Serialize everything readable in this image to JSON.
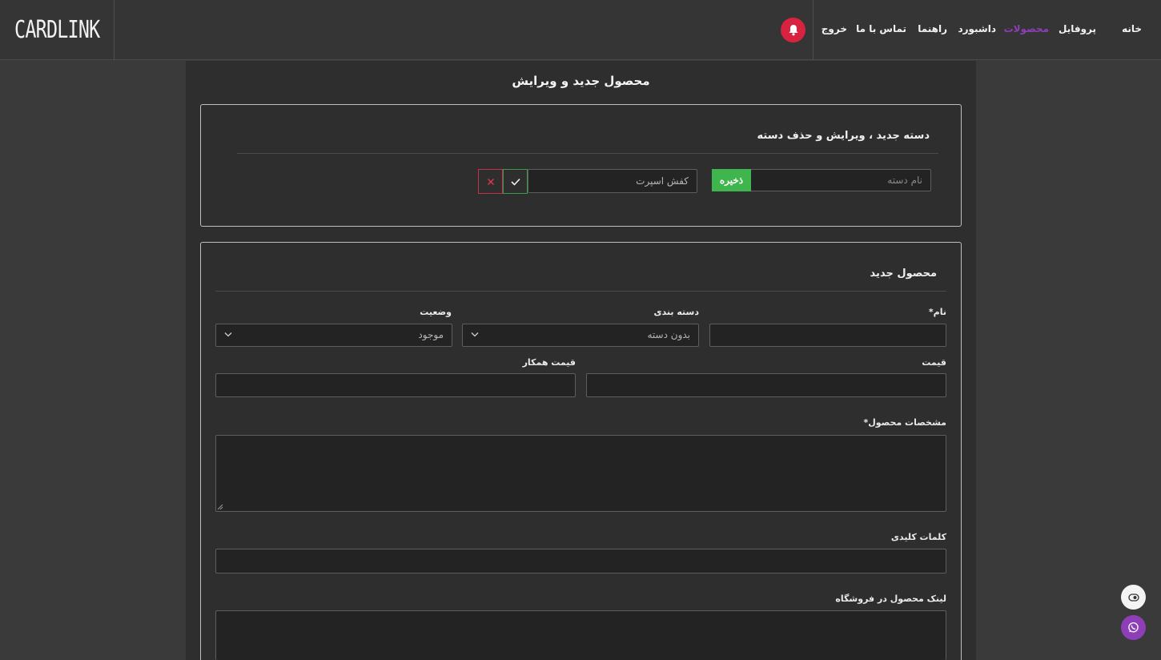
{
  "header": {
    "logo": "CARDLINK",
    "nav": [
      {
        "label": "خانه"
      },
      {
        "label": "پروفایل"
      },
      {
        "label": "محصولات"
      },
      {
        "label": "داشبورد"
      },
      {
        "label": "راهنما"
      },
      {
        "label": "تماس با ما"
      },
      {
        "label": "خروج"
      }
    ],
    "active_nav": "محصولات"
  },
  "page": {
    "title": "محصول جدید و ویرایش"
  },
  "category_card": {
    "title": "دسته جدید ، ویرایش و حذف دسته",
    "new_category_placeholder": "نام دسته",
    "save_label": "ذخیره",
    "edit_category_value": "کفش اسپرت"
  },
  "product_card": {
    "title": "محصول جدید",
    "name_label": "نام*",
    "category_label": "دسته بندی",
    "category_value": "بدون دسته",
    "status_label": "وضعیت",
    "status_value": "موجود",
    "price_label": "قیمت",
    "partner_price_label": "قیمت همکار",
    "specs_label": "مشخصات محصول*",
    "keywords_label": "کلمات کلیدی",
    "store_link_label": "لینک محصول در فروشگاه"
  },
  "colors": {
    "accent_purple": "#8e3fb8",
    "save_green": "#3fb54e",
    "bell_red": "#d7233f",
    "whatsapp_purple": "#8e3fb8"
  },
  "icons": [
    "bell-icon",
    "check-icon",
    "close-icon",
    "chevron-down-icon",
    "eye-toggle-icon",
    "whatsapp-icon"
  ]
}
